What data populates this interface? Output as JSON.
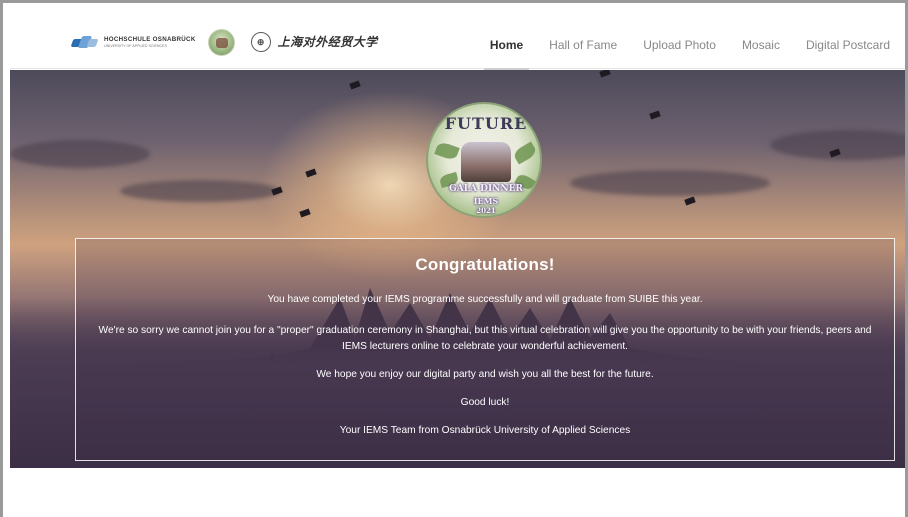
{
  "navbar": {
    "logo_hs": {
      "name": "HOCHSCHULE OSNABRÜCK",
      "subtitle": "UNIVERSITY OF APPLIED SCIENCES"
    },
    "logo_suibe": {
      "seal": "⊕",
      "chinese_name": "上海对外经贸大学"
    },
    "items": [
      {
        "label": "Home",
        "active": true
      },
      {
        "label": "Hall of Fame",
        "active": false
      },
      {
        "label": "Upload Photo",
        "active": false
      },
      {
        "label": "Mosaic",
        "active": false
      },
      {
        "label": "Digital Postcard",
        "active": false
      }
    ]
  },
  "hero": {
    "badge": {
      "top_text": "FUTURE",
      "mid_text": "GALA DINNER",
      "iems_text": "IEMS",
      "year_text": "2021"
    },
    "message": {
      "title": "Congratulations!",
      "p1": "You have completed your IEMS programme successfully and will graduate from SUIBE this year.",
      "p2": "We're so sorry we cannot join you for a \"proper\" graduation ceremony in Shanghai, but this virtual celebration will give you the opportunity to be with your friends, peers and IEMS lecturers online to celebrate your wonderful achievement.",
      "p3": "We hope you enjoy our digital party and wish you all the best for the future.",
      "p4": "Good luck!",
      "p5": "Your IEMS Team from Osnabrück University of Applied Sciences"
    }
  },
  "colors": {
    "nav_active": "#333333",
    "nav_inactive": "#888888",
    "hero_text": "#ffffff"
  }
}
